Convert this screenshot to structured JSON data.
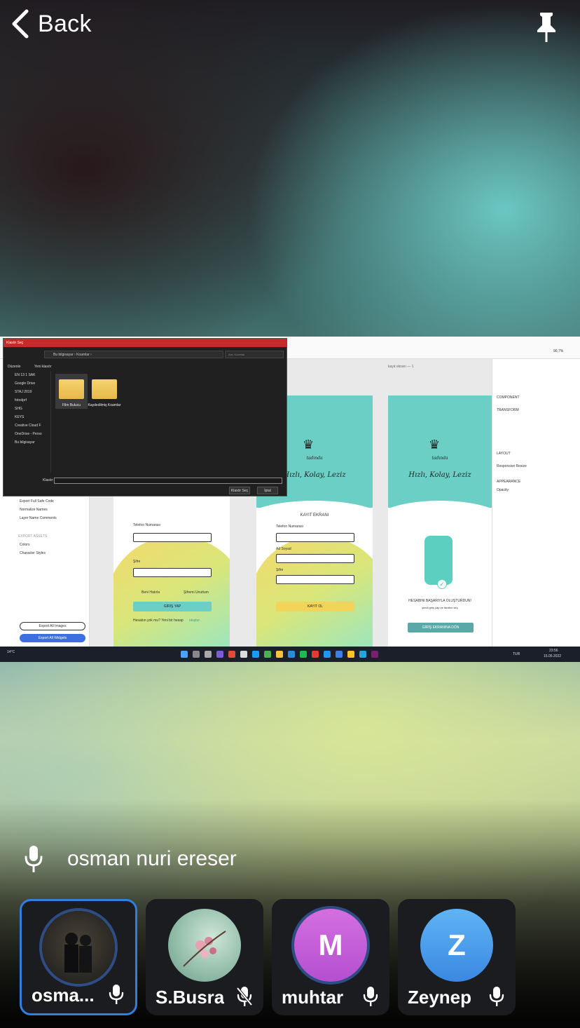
{
  "header": {
    "back_label": "Back"
  },
  "shared_screen": {
    "dialog": {
      "title": "Klasör Seç",
      "address": "Bu bilgisayar › Koamlar ›",
      "search_placeholder": "Ara: Koamlar",
      "toolbar": [
        "Düzenle",
        "Yeni klasör"
      ],
      "sidebar": [
        "EN 13 1 SAK",
        "Google Drive",
        "STAJ 2019",
        "fotodprf",
        "SHG",
        "KEYS",
        "Creative Cloud F",
        "OneDrive - Perso",
        "Bu bilgisayar"
      ],
      "folders": [
        "Film Bulucu",
        "Kaydedilmiş Koamlar"
      ],
      "filename_label": "Klasör:",
      "buttons": [
        "Klasör Seç",
        "İptal"
      ]
    },
    "artboard_2_label": "kayıt ekranı — 1",
    "artboards": [
      {
        "phone_label": "Telefon Numarası",
        "password_label": "Şifre",
        "remember": "Beni Hatırla",
        "forgot": "Şifremi Unuttum",
        "button": "GİRİŞ YAP",
        "footer": "Hesabın yok mu? Yeni bir hesap",
        "footer_link": "oluştur"
      },
      {
        "slogan": "Hızlı, Kolay, Leziz",
        "title": "KAYIT EKRANI",
        "phone_label": "Telefon Numarası",
        "name_label": "Ad Soyad",
        "password_label": "Şifre",
        "button": "KAYIT OL"
      },
      {
        "slogan": "Hızlı, Kolay, Leziz",
        "success": "HESABINI BAŞARIYLA OLUŞTURDUN!",
        "success_sub": "şimdi giriş yap ve tarafını seç",
        "button": "GİRİŞ EKRANINA DÖN"
      }
    ],
    "logo_word": "tadında",
    "left_panel": [
      "Export Full Safe Code",
      "Normalize Names",
      "Layer Name Comments"
    ],
    "left_export_title": "EXPORT ASSETS",
    "left_export_items": [
      "Colors",
      "Character Styles"
    ],
    "left_buttons": [
      "Export All Images",
      "Export All Widgets"
    ],
    "right_panel": [
      "COMPONENT",
      "TRANSFORM",
      "LAYOUT",
      "Responsive Resize",
      "APPEARANCE",
      "Opacity"
    ],
    "zoom": "90,7%",
    "weather": "14°C",
    "clock_time": "23:56",
    "clock_date": "15.05.2022",
    "lang": "TUR"
  },
  "speaker": {
    "name": "osman nuri ereser"
  },
  "participants": [
    {
      "name": "osma...",
      "initial": "",
      "muted": false,
      "active": true,
      "avatar_color": "#2b2f36"
    },
    {
      "name": "S.Busra",
      "initial": "",
      "muted": true,
      "active": false,
      "avatar_color": "#9fc3b2"
    },
    {
      "name": "muhtar",
      "initial": "M",
      "muted": false,
      "active": false,
      "avatar_color": "#c060d8"
    },
    {
      "name": "Zeynep",
      "initial": "Z",
      "muted": false,
      "active": false,
      "avatar_color": "#3a90e8"
    }
  ]
}
